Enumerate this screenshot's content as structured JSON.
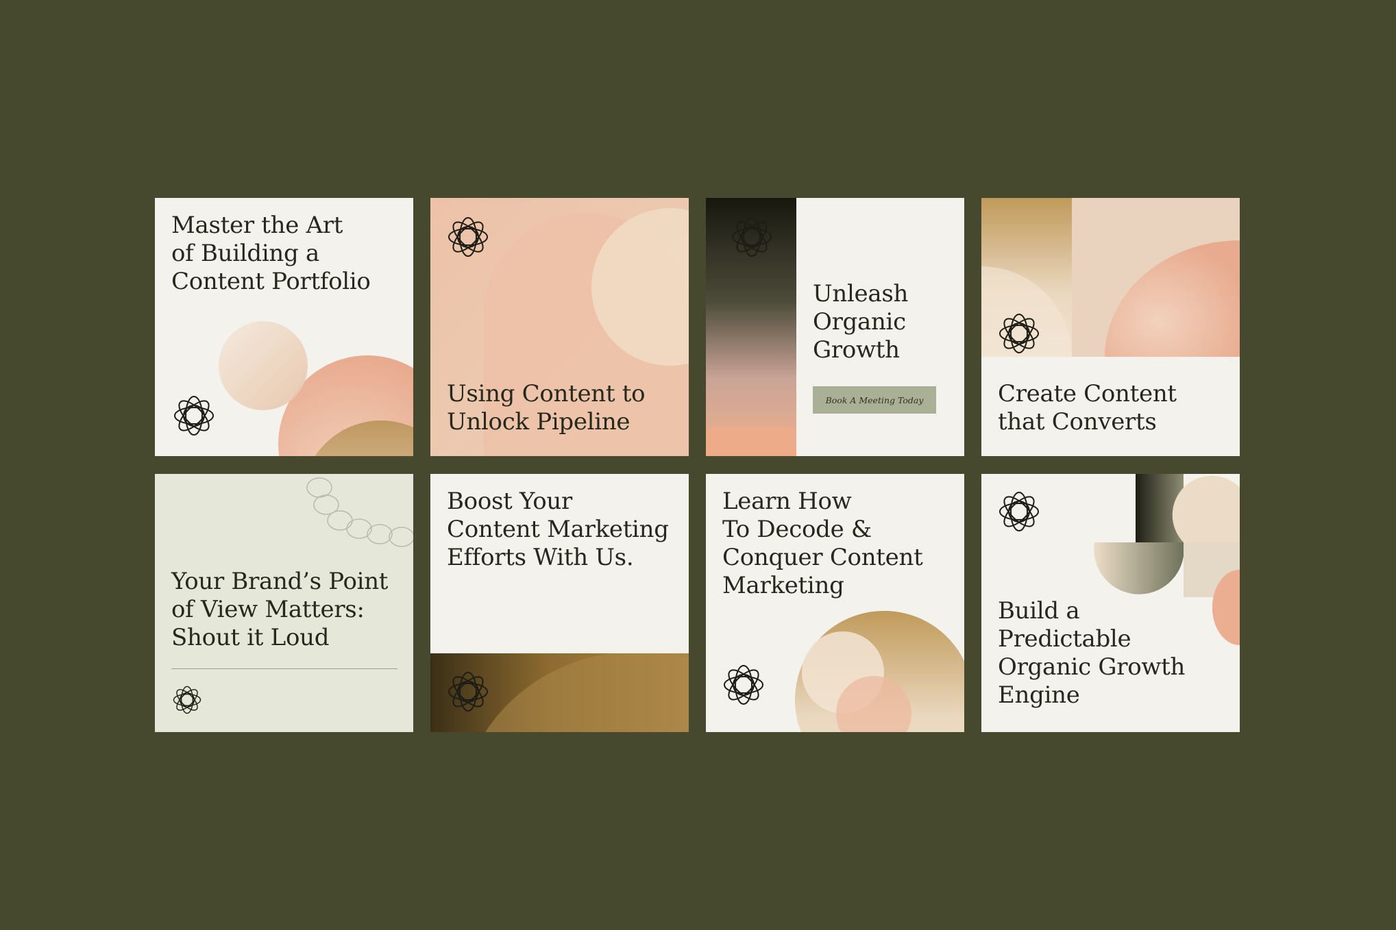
{
  "cards": [
    {
      "headline": "Master the Art\nof Building a\nContent Portfolio"
    },
    {
      "headline": "Using Content to\nUnlock Pipeline"
    },
    {
      "headline": "Unleash\nOrganic\nGrowth",
      "cta": "Book A Meeting Today"
    },
    {
      "headline": "Create Content\nthat Converts"
    },
    {
      "headline": "Your Brand’s Point\nof View Matters:\nShout it Loud"
    },
    {
      "headline": "Boost Your\nContent Marketing\nEfforts With Us."
    },
    {
      "headline": "Learn How\nTo Decode &\nConquer Content\nMarketing"
    },
    {
      "headline": "Build a\nPredictable\nOrganic Growth\nEngine"
    }
  ],
  "colors": {
    "background": "#47492f",
    "card": "#f3f2ec",
    "sage_card": "#e5e8d9",
    "peach": "#e9b79c",
    "bronze": "#9a7a3c",
    "dark": "#2a2b1f",
    "cta": "#a9b096"
  },
  "icons": [
    "knot-logo-icon"
  ]
}
